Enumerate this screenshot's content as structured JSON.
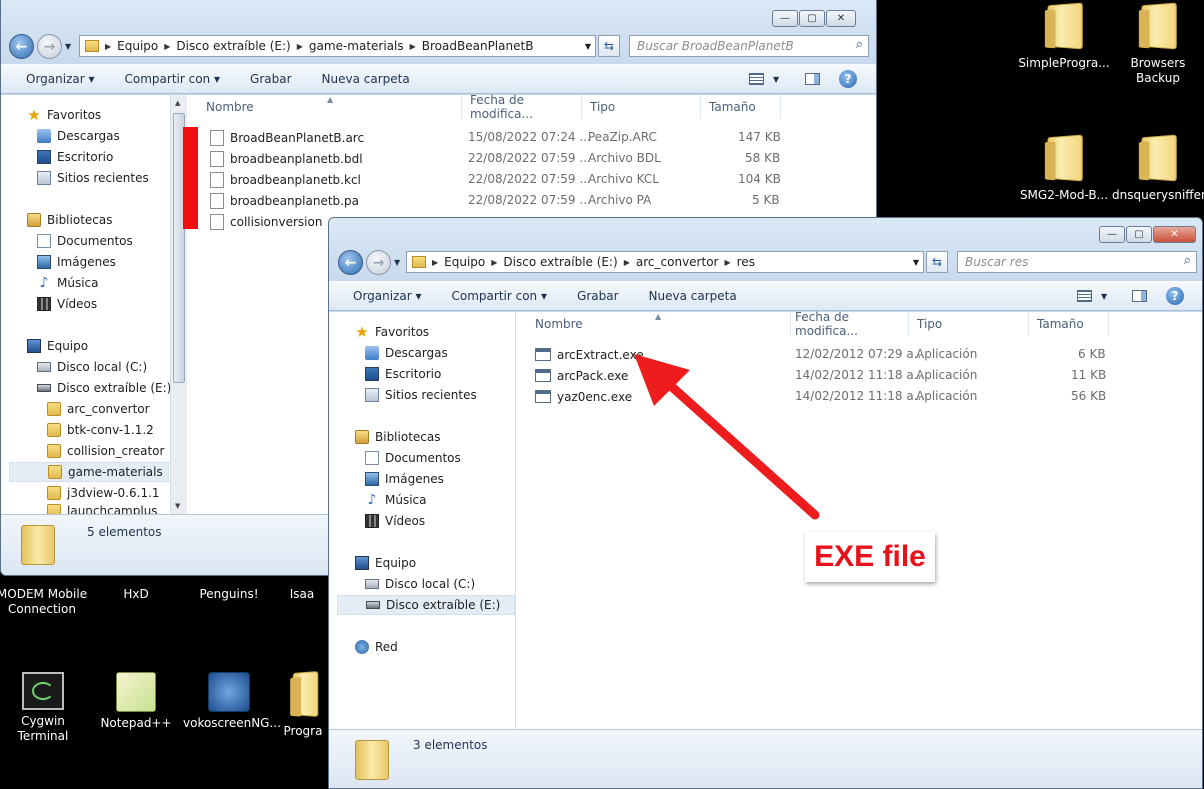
{
  "desktop": {
    "icons_right": [
      {
        "label": "SimpleProgra..."
      },
      {
        "label": "Browsers Backup"
      },
      {
        "label": "SMG2-Mod-B..."
      },
      {
        "label": "dnsquerysniffer"
      }
    ],
    "icons_bottom": [
      {
        "label": "MODEM Mobile Connection"
      },
      {
        "label": "HxD"
      },
      {
        "label": "Penguins!"
      },
      {
        "label": "Isaa"
      },
      {
        "label": "Cygwin Terminal"
      },
      {
        "label": "Notepad++"
      },
      {
        "label": "vokoscreenNG..."
      },
      {
        "label": "Progra"
      }
    ]
  },
  "window1": {
    "breadcrumb": [
      "Equipo",
      "Disco extraíble (E:)",
      "game-materials",
      "BroadBeanPlanetB"
    ],
    "search_placeholder": "Buscar BroadBeanPlanetB",
    "toolbar": {
      "organize": "Organizar",
      "share": "Compartir con",
      "burn": "Grabar",
      "new_folder": "Nueva carpeta"
    },
    "nav": {
      "favorites": "Favoritos",
      "downloads": "Descargas",
      "desktop": "Escritorio",
      "recent": "Sitios recientes",
      "libraries": "Bibliotecas",
      "documents": "Documentos",
      "images": "Imágenes",
      "music": "Música",
      "videos": "Vídeos",
      "computer": "Equipo",
      "local_disk": "Disco local (C:)",
      "removable": "Disco extraíble (E:)",
      "folders": [
        "arc_convertor",
        "btk-conv-1.1.2",
        "collision_creator",
        "game-materials",
        "j3dview-0.6.1.1",
        "launchcamplus"
      ]
    },
    "columns": {
      "name": "Nombre",
      "date": "Fecha de modifica...",
      "type": "Tipo",
      "size": "Tamaño"
    },
    "files": [
      {
        "name": "BroadBeanPlanetB.arc",
        "date": "15/08/2022 07:24 ...",
        "type": "PeaZip.ARC",
        "size": "147 KB"
      },
      {
        "name": "broadbeanplanetb.bdl",
        "date": "22/08/2022 07:59 ...",
        "type": "Archivo BDL",
        "size": "58 KB"
      },
      {
        "name": "broadbeanplanetb.kcl",
        "date": "22/08/2022 07:59 ...",
        "type": "Archivo KCL",
        "size": "104 KB"
      },
      {
        "name": "broadbeanplanetb.pa",
        "date": "22/08/2022 07:59 ...",
        "type": "Archivo PA",
        "size": "5 KB"
      },
      {
        "name": "collisionversion",
        "date": "",
        "type": "",
        "size": ""
      }
    ],
    "status": "5 elementos"
  },
  "window2": {
    "breadcrumb": [
      "Equipo",
      "Disco extraíble (E:)",
      "arc_convertor",
      "res"
    ],
    "search_placeholder": "Buscar res",
    "toolbar": {
      "organize": "Organizar",
      "share": "Compartir con",
      "burn": "Grabar",
      "new_folder": "Nueva carpeta"
    },
    "nav": {
      "favorites": "Favoritos",
      "downloads": "Descargas",
      "desktop": "Escritorio",
      "recent": "Sitios recientes",
      "libraries": "Bibliotecas",
      "documents": "Documentos",
      "images": "Imágenes",
      "music": "Música",
      "videos": "Vídeos",
      "computer": "Equipo",
      "local_disk": "Disco local (C:)",
      "removable": "Disco extraíble (E:)",
      "network": "Red"
    },
    "columns": {
      "name": "Nombre",
      "date": "Fecha de modifica...",
      "type": "Tipo",
      "size": "Tamaño"
    },
    "files": [
      {
        "name": "arcExtract.exe",
        "date": "12/02/2012 07:29 a...",
        "type": "Aplicación",
        "size": "6 KB"
      },
      {
        "name": "arcPack.exe",
        "date": "14/02/2012 11:18 a...",
        "type": "Aplicación",
        "size": "11 KB"
      },
      {
        "name": "yaz0enc.exe",
        "date": "14/02/2012 11:18 a...",
        "type": "Aplicación",
        "size": "56 KB"
      }
    ],
    "status": "3 elementos"
  },
  "annotation": {
    "label": "EXE file",
    "color": "#e8101a"
  }
}
